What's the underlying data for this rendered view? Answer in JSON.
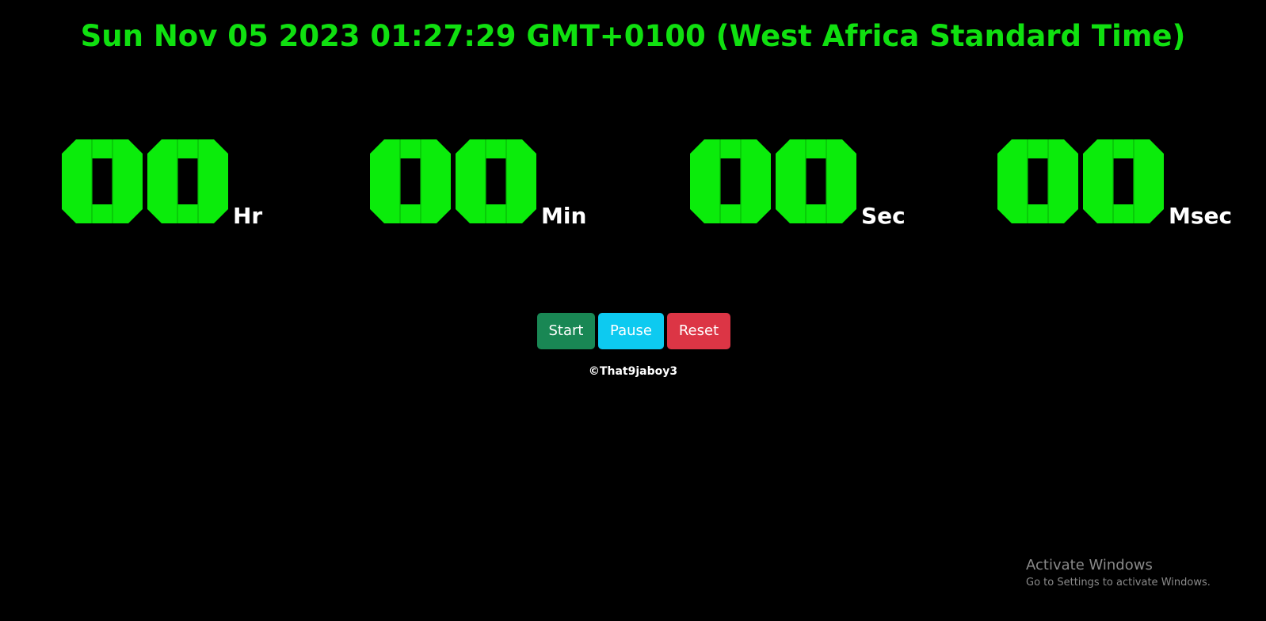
{
  "clock": {
    "datetime": "Sun Nov 05 2023 01:27:29 GMT+0100 (West Africa Standard Time)"
  },
  "stopwatch": {
    "units": [
      {
        "name": "hours",
        "digits": "00",
        "label": "Hr"
      },
      {
        "name": "minutes",
        "digits": "00",
        "label": "Min"
      },
      {
        "name": "seconds",
        "digits": "00",
        "label": "Sec"
      },
      {
        "name": "milliseconds",
        "digits": "00",
        "label": "Msec"
      }
    ]
  },
  "controls": {
    "start_label": "Start",
    "pause_label": "Pause",
    "reset_label": "Reset"
  },
  "footer": {
    "copyright": "©That9jaboy3"
  },
  "os_watermark": {
    "title": "Activate Windows",
    "subtitle": "Go to Settings to activate Windows."
  },
  "colors": {
    "background": "#000000",
    "digit_green": "#0bec0b",
    "datetime_green": "#10e010",
    "start_button": "#198754",
    "pause_button": "#0dcaf0",
    "reset_button": "#dc3545"
  }
}
